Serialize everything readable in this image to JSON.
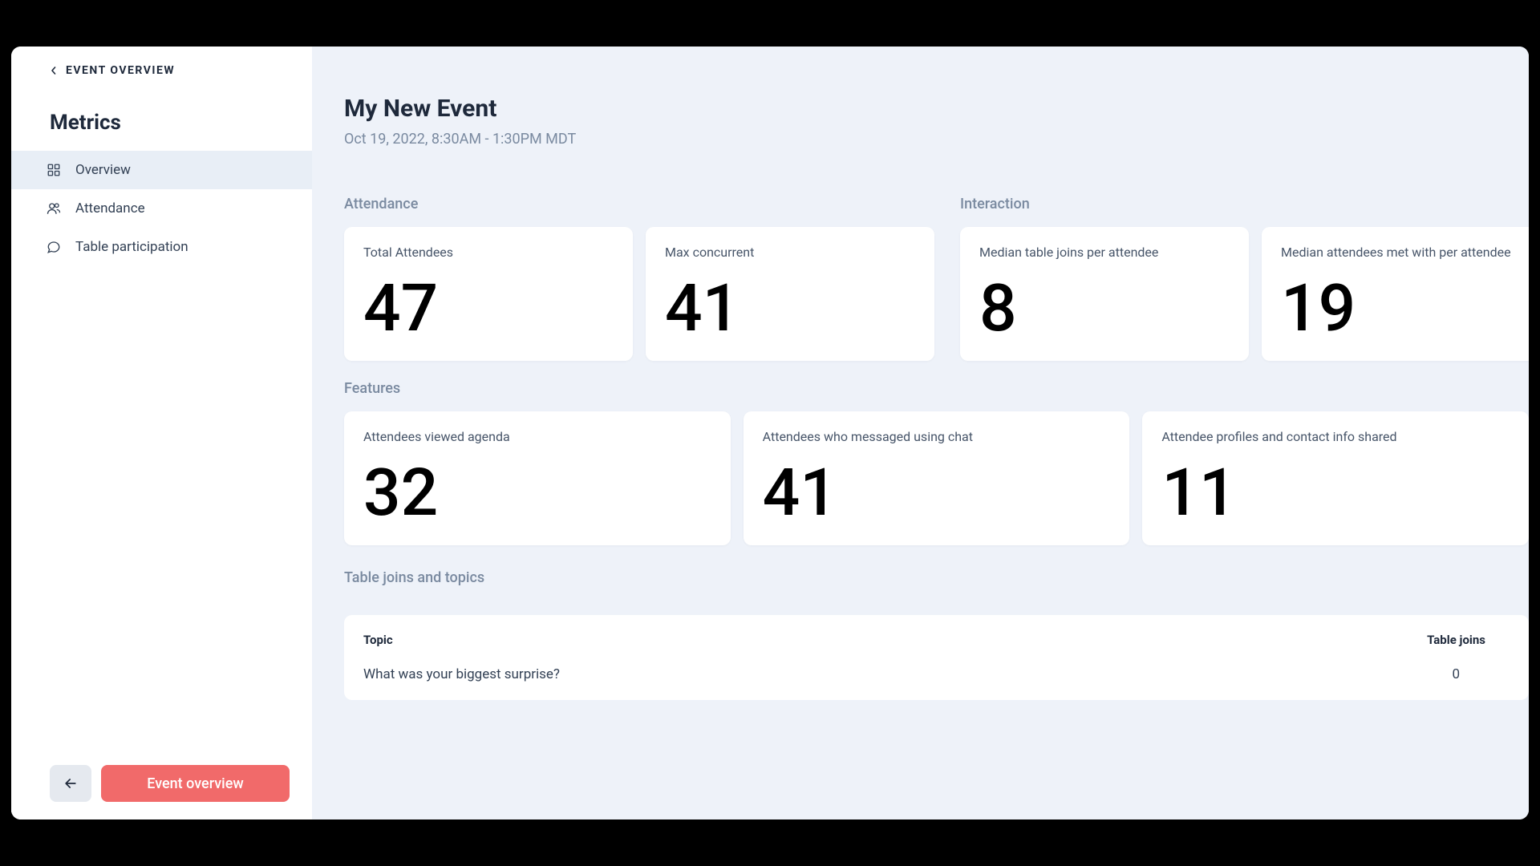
{
  "sidebar": {
    "breadcrumb": "EVENT OVERVIEW",
    "title": "Metrics",
    "nav": [
      {
        "label": "Overview",
        "icon": "grid"
      },
      {
        "label": "Attendance",
        "icon": "users"
      },
      {
        "label": "Table participation",
        "icon": "chat"
      }
    ],
    "footer_button": "Event overview"
  },
  "main": {
    "event_title": "My New Event",
    "event_datetime": "Oct 19, 2022, 8:30AM - 1:30PM MDT",
    "sections": {
      "attendance": {
        "label": "Attendance",
        "cards": [
          {
            "label": "Total Attendees",
            "value": "47"
          },
          {
            "label": "Max concurrent",
            "value": "41"
          }
        ]
      },
      "interaction": {
        "label": "Interaction",
        "cards": [
          {
            "label": "Median table joins per attendee",
            "value": "8"
          },
          {
            "label": "Median attendees met with per attendee",
            "value": "19"
          }
        ]
      },
      "features": {
        "label": "Features",
        "cards": [
          {
            "label": "Attendees viewed agenda",
            "value": "32"
          },
          {
            "label": "Attendees who messaged using chat",
            "value": "41"
          },
          {
            "label": "Attendee profiles and contact info shared",
            "value": "11"
          }
        ]
      },
      "table_joins": {
        "label": "Table joins and topics",
        "columns": {
          "topic": "Topic",
          "joins": "Table joins"
        },
        "rows": [
          {
            "topic": "What was your biggest surprise?",
            "joins": "0"
          }
        ]
      }
    }
  }
}
